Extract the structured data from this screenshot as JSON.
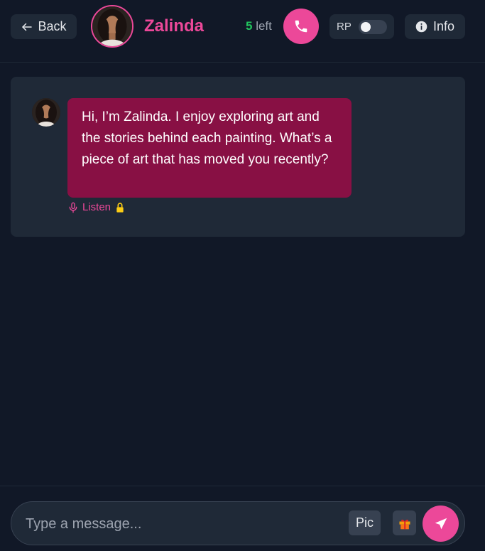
{
  "header": {
    "back_label": "Back",
    "character_name": "Zalinda",
    "remaining_count": "5",
    "remaining_suffix": "left",
    "rp_label": "RP",
    "rp_enabled": false,
    "info_label": "Info"
  },
  "chat": {
    "messages": [
      {
        "sender": "Zalinda",
        "text": "Hi, I’m Zalinda. I enjoy exploring art and the stories behind each painting. What’s a piece of art that has moved you recently?",
        "listen_label": "Listen"
      }
    ]
  },
  "composer": {
    "placeholder": "Type a message...",
    "pic_label": "Pic"
  },
  "colors": {
    "accent": "#ec4899",
    "bubble": "#881044",
    "background": "#111827",
    "panel": "#1f2937",
    "count_green": "#22c55e"
  },
  "icons": {
    "back": "arrow-left-icon",
    "call": "phone-icon",
    "info": "info-icon",
    "listen": "microphone-icon",
    "lock": "lock-icon",
    "gift": "gift-icon",
    "send": "send-icon"
  }
}
